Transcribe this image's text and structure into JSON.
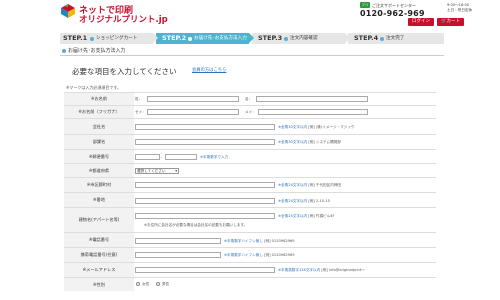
{
  "header": {
    "logo_line1": "ネットで印刷",
    "logo_line2": "オリジナルプリント.jp",
    "support_label": "ご注文サポートセンター",
    "support_phone": "0120-962-969",
    "free_icon": "フリー",
    "hours_line1": "9:00～18:00",
    "hours_line2": "土日・祝日定休",
    "login_label": "ログイン",
    "cart_label": "カート"
  },
  "steps": [
    {
      "num": "STEP.1",
      "label": "ショッピングカート",
      "active": false
    },
    {
      "num": "STEP.2",
      "label": "お届け先･お支払方法入力",
      "active": true
    },
    {
      "num": "STEP.3",
      "label": "注文内容確認",
      "active": false
    },
    {
      "num": "STEP.4",
      "label": "注文完了",
      "active": false
    }
  ],
  "section_title": "お届け先･お支払方法入力",
  "heading": "必要な項目を入力してください",
  "member_link": "会員の方はこちら",
  "required_note": "※マークは入力必須項目です。",
  "rows": {
    "name": {
      "label": "※お名前",
      "sei": "姓：",
      "mei": "名："
    },
    "kana": {
      "label": "※お名前（フリガナ）",
      "sei": "セイ：",
      "mei": "メイ："
    },
    "company": {
      "label": "会社名",
      "hint_blue": "※全角30文字以内",
      "hint_gray": "[例] (株)イメージ・マジック"
    },
    "dept": {
      "label": "部課名",
      "hint_blue": "※全角30文字以内",
      "hint_gray": "[例] システム開発部"
    },
    "zip": {
      "label": "※郵便番号",
      "dash": "-",
      "hint_blue": "※半角数字で入力"
    },
    "pref": {
      "label": "※都道府県",
      "select_value": "選択してください"
    },
    "city": {
      "label": "※市区郡町村",
      "hint_blue": "※全角24文字以内",
      "hint_gray": "[例] 千代田区内神田"
    },
    "banchi": {
      "label": "※番地",
      "hint_blue": "※全角24文字以内",
      "hint_gray": "[例] 2-15-15"
    },
    "bldg": {
      "label": "建物名(アパート名等)",
      "hint_blue": "※全角24文字以内",
      "hint_gray": "[例] 竹橋ビル4F",
      "warn": "※お住所に会社名が必要な場合は会社名の記載もお願いします。"
    },
    "tel": {
      "label": "※電話番号",
      "hint_blue": "※半角数字ハイフン無し",
      "hint_gray": "[例] 0120962969"
    },
    "mobile": {
      "label": "携帯電話番号(任意)",
      "hint_blue": "※半角数字ハイフン無し",
      "hint_gray": "[例] 0120962969"
    },
    "email": {
      "label": "※メールアドレス",
      "hint_blue": "※半角英数字128文字以内",
      "hint_gray": "[例] info@originalprint～"
    },
    "gender": {
      "label": "※性別",
      "male": "男性",
      "female": "女性"
    }
  },
  "colors": {
    "brand_red": "#c8102e",
    "step_active": "#4fb3cf",
    "link_blue": "#2f6fbd"
  }
}
